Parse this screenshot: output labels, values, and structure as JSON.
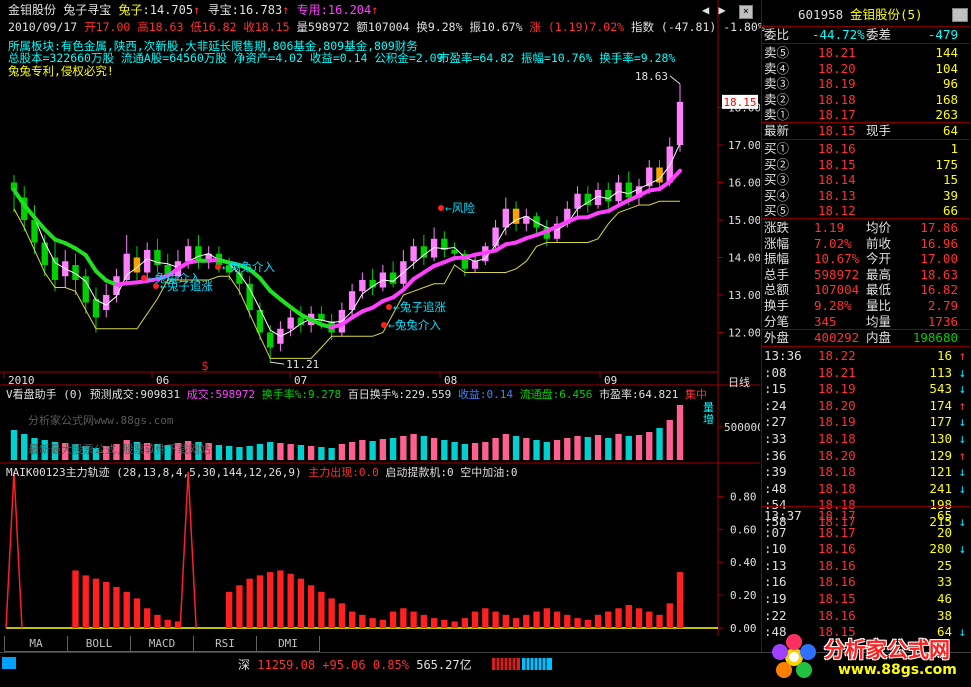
{
  "header": {
    "stock_name": "金钼股份",
    "indicator_name": "兔子寻宝",
    "rabbit_label": "兔子",
    "rabbit_value": "14.705",
    "xunbao_label": "寻宝",
    "xunbao_value": "16.783",
    "zhuanyong_label": "专用",
    "zhuanyong_value": "16.204",
    "window_buttons": [
      "◀",
      "▶",
      "×"
    ]
  },
  "quote_line": {
    "date": "2010/09/17",
    "open": "开17.00",
    "high": "高18.63",
    "low": "低16.82",
    "close": "收18.15",
    "volume": "量598972",
    "amount": "额107004",
    "turnover": "换9.28%",
    "amplitude": "振10.67%",
    "change": "涨 (1.19)7.02%",
    "index": "指数 (-47.81) -1.80%"
  },
  "info_lines": [
    "所属板块:有色金属,陕西,次新股,大非延长限售期,806基金,809基金,809财务",
    "总股本=322660万股 流通A股=64560万股 净资产=4.02 收益=0.14 公积金=2.09",
    "市盈率=64.82 振幅=10.76% 换手率=9.28%",
    "兔兔专利,侵权必究!"
  ],
  "price_axis": [
    "18.00",
    "17.00",
    "16.00",
    "15.00",
    "14.00",
    "13.00",
    "12.00"
  ],
  "price_marker": "18.15",
  "price_high_label": "18.63",
  "price_low_label": "11.21",
  "annotations": [
    "兔兔介入",
    "兔子追涨",
    "兔兔介入",
    "风险",
    "兔子追涨",
    "兔兔介入"
  ],
  "date_axis": [
    "2010",
    "06",
    "07",
    "08",
    "09"
  ],
  "period_label": "日线",
  "volume_header": {
    "title": "V看盘助手 (0)",
    "forecast": "预测成交:909831",
    "volume": "成交:598972",
    "turnover_pct": "换手率%:9.278",
    "hundred_day": "百日换手%:229.559",
    "earnings": "收益:0.14",
    "float": "流通盘:6.456",
    "pe": "市盈率:64.821",
    "concentrate": "集中",
    "volume_tag": "量增",
    "axis": "500000"
  },
  "watermarks": [
    "分析家公式网www.88gs.com",
    "最新最大股票公式,股票软件下载网站"
  ],
  "indicator_header": {
    "title": "MAIK00123主力轨迹",
    "params": "(28,13,8,4,5,30,144,12,26,9)",
    "main_force": "主力出现:0.0",
    "pull_up": "启动提款机:0",
    "air_refuel": "空中加油:0",
    "axis": [
      "0.80",
      "0.60",
      "0.40",
      "0.20",
      "0.00"
    ]
  },
  "tabs": [
    "MA",
    "BOLL",
    "MACD",
    "RSI",
    "DMI"
  ],
  "status": {
    "market": "深",
    "index_value": "11259.08",
    "change": "+95.06",
    "pct": "0.85%",
    "amount": "565.27亿"
  },
  "logo_text": "分析家公式网",
  "logo_url": "www.88gs.com",
  "panel": {
    "code": "601958",
    "name": "金钼股份(5)",
    "weibi_label": "委比",
    "weibi_value": "-44.72%",
    "weicha_label": "委差",
    "weicha_value": "-479",
    "sell": [
      {
        "label": "卖⑤",
        "price": "18.21",
        "vol": "144"
      },
      {
        "label": "卖④",
        "price": "18.20",
        "vol": "104"
      },
      {
        "label": "卖③",
        "price": "18.19",
        "vol": "96"
      },
      {
        "label": "卖②",
        "price": "18.18",
        "vol": "168"
      },
      {
        "label": "卖①",
        "price": "18.17",
        "vol": "263"
      }
    ],
    "latest_label": "最新",
    "latest_value": "18.15",
    "hand_label": "现手",
    "hand_value": "64",
    "buy": [
      {
        "label": "买①",
        "price": "18.16",
        "vol": "1"
      },
      {
        "label": "买②",
        "price": "18.15",
        "vol": "175"
      },
      {
        "label": "买③",
        "price": "18.14",
        "vol": "15"
      },
      {
        "label": "买④",
        "price": "18.13",
        "vol": "39"
      },
      {
        "label": "买⑤",
        "price": "18.12",
        "vol": "66"
      }
    ],
    "stats": [
      {
        "l1": "涨跌",
        "v1": "1.19",
        "l2": "均价",
        "v2": "17.86"
      },
      {
        "l1": "涨幅",
        "v1": "7.02%",
        "l2": "前收",
        "v2": "16.96"
      },
      {
        "l1": "振幅",
        "v1": "10.67%",
        "l2": "今开",
        "v2": "17.00"
      },
      {
        "l1": "总手",
        "v1": "598972",
        "l2": "最高",
        "v2": "18.63"
      },
      {
        "l1": "总额",
        "v1": "107004",
        "l2": "最低",
        "v2": "16.82"
      },
      {
        "l1": "换手",
        "v1": "9.28%",
        "l2": "量比",
        "v2": "2.79"
      },
      {
        "l1": "分笔",
        "v1": "345",
        "l2": "均量",
        "v2": "1736"
      }
    ],
    "outer_label": "外盘",
    "outer_value": "400292",
    "inner_label": "内盘",
    "inner_value": "198680",
    "ticks_a": [
      {
        "t": "13:36",
        "p": "18.22",
        "v": "16",
        "dir": "↑",
        "col": "#ff3030"
      },
      {
        "t": ":08",
        "p": "18.21",
        "v": "113",
        "dir": "↓",
        "col": "#ff3030"
      },
      {
        "t": ":15",
        "p": "18.19",
        "v": "543",
        "dir": "↓",
        "col": "#ff3030"
      },
      {
        "t": ":24",
        "p": "18.20",
        "v": "174",
        "dir": "↑",
        "col": "#ff3030"
      },
      {
        "t": ":27",
        "p": "18.19",
        "v": "177",
        "dir": "↓",
        "col": "#ff3030"
      },
      {
        "t": ":33",
        "p": "18.18",
        "v": "130",
        "dir": "↓",
        "col": "#ff3030"
      },
      {
        "t": ":36",
        "p": "18.20",
        "v": "129",
        "dir": "↑",
        "col": "#ff3030"
      },
      {
        "t": ":39",
        "p": "18.18",
        "v": "121",
        "dir": "↓",
        "col": "#ff3030"
      },
      {
        "t": ":48",
        "p": "18.18",
        "v": "241",
        "dir": "↓",
        "col": "#ff3030"
      },
      {
        "t": ":54",
        "p": "18.18",
        "v": "198",
        "dir": "",
        "col": "#ff3030"
      },
      {
        "t": ":58",
        "p": "18.17",
        "v": "215",
        "dir": "↓",
        "col": "#ff3030"
      }
    ],
    "ticks_b": [
      {
        "t": "13:37",
        "p": "18.17",
        "v": "65",
        "dir": "",
        "col": "#ff3030"
      },
      {
        "t": ":07",
        "p": "18.17",
        "v": "20",
        "dir": "",
        "col": "#ff3030"
      },
      {
        "t": ":10",
        "p": "18.16",
        "v": "280",
        "dir": "↓",
        "col": "#ff3030"
      },
      {
        "t": ":13",
        "p": "18.16",
        "v": "25",
        "dir": "",
        "col": "#ff3030"
      },
      {
        "t": ":16",
        "p": "18.16",
        "v": "33",
        "dir": "",
        "col": "#ff3030"
      },
      {
        "t": ":19",
        "p": "18.15",
        "v": "46",
        "dir": "",
        "col": "#ff3030"
      },
      {
        "t": ":22",
        "p": "18.16",
        "v": "38",
        "dir": "",
        "col": "#ff3030"
      },
      {
        "t": ":48",
        "p": "18.15",
        "v": "64",
        "dir": "↓",
        "col": "#ff3030"
      }
    ]
  },
  "chart_data": {
    "type": "candlestick",
    "title": "",
    "ylim": [
      11.0,
      19.0
    ],
    "candles": [
      {
        "o": 16.0,
        "c": 15.8,
        "h": 16.2,
        "l": 15.2
      },
      {
        "o": 15.6,
        "c": 15.0,
        "h": 15.9,
        "l": 14.7
      },
      {
        "o": 15.0,
        "c": 14.4,
        "h": 15.4,
        "l": 14.1
      },
      {
        "o": 14.4,
        "c": 13.8,
        "h": 14.6,
        "l": 13.5
      },
      {
        "o": 14.0,
        "c": 13.4,
        "h": 14.5,
        "l": 13.1
      },
      {
        "o": 13.5,
        "c": 13.9,
        "h": 14.2,
        "l": 13.2
      },
      {
        "o": 13.8,
        "c": 13.4,
        "h": 14.1,
        "l": 13.0
      },
      {
        "o": 13.5,
        "c": 12.8,
        "h": 13.7,
        "l": 12.5
      },
      {
        "o": 12.9,
        "c": 12.4,
        "h": 13.2,
        "l": 12.0
      },
      {
        "o": 12.6,
        "c": 13.0,
        "h": 13.3,
        "l": 12.4
      },
      {
        "o": 13.0,
        "c": 13.5,
        "h": 13.7,
        "l": 12.8
      },
      {
        "o": 13.4,
        "c": 14.1,
        "h": 14.6,
        "l": 13.3
      },
      {
        "o": 14.0,
        "c": 13.6,
        "h": 14.3,
        "l": 13.4
      },
      {
        "o": 13.6,
        "c": 14.2,
        "h": 14.4,
        "l": 13.4
      },
      {
        "o": 14.2,
        "c": 13.8,
        "h": 14.5,
        "l": 13.6
      },
      {
        "o": 13.8,
        "c": 13.5,
        "h": 14.1,
        "l": 13.3
      },
      {
        "o": 13.5,
        "c": 13.9,
        "h": 14.2,
        "l": 13.4
      },
      {
        "o": 13.9,
        "c": 14.3,
        "h": 14.5,
        "l": 13.7
      },
      {
        "o": 14.3,
        "c": 13.9,
        "h": 14.6,
        "l": 13.7
      },
      {
        "o": 13.9,
        "c": 14.1,
        "h": 14.3,
        "l": 13.7
      },
      {
        "o": 14.1,
        "c": 13.8,
        "h": 14.3,
        "l": 13.6
      },
      {
        "o": 13.8,
        "c": 13.6,
        "h": 14.0,
        "l": 13.4
      },
      {
        "o": 13.6,
        "c": 13.3,
        "h": 13.8,
        "l": 13.0
      },
      {
        "o": 13.3,
        "c": 12.6,
        "h": 13.5,
        "l": 12.4
      },
      {
        "o": 12.6,
        "c": 12.0,
        "h": 12.8,
        "l": 11.8
      },
      {
        "o": 12.0,
        "c": 11.6,
        "h": 12.2,
        "l": 11.21
      },
      {
        "o": 11.7,
        "c": 12.1,
        "h": 12.3,
        "l": 11.5
      },
      {
        "o": 12.1,
        "c": 12.4,
        "h": 12.6,
        "l": 11.9
      },
      {
        "o": 12.4,
        "c": 12.2,
        "h": 12.7,
        "l": 12.0
      },
      {
        "o": 12.2,
        "c": 12.5,
        "h": 12.7,
        "l": 12.0
      },
      {
        "o": 12.5,
        "c": 12.3,
        "h": 12.7,
        "l": 12.1
      },
      {
        "o": 12.3,
        "c": 12.0,
        "h": 12.5,
        "l": 11.8
      },
      {
        "o": 12.0,
        "c": 12.6,
        "h": 12.8,
        "l": 11.9
      },
      {
        "o": 12.6,
        "c": 13.1,
        "h": 13.3,
        "l": 12.4
      },
      {
        "o": 13.1,
        "c": 13.4,
        "h": 13.6,
        "l": 12.9
      },
      {
        "o": 13.4,
        "c": 13.2,
        "h": 13.7,
        "l": 13.0
      },
      {
        "o": 13.2,
        "c": 13.6,
        "h": 13.8,
        "l": 13.1
      },
      {
        "o": 13.6,
        "c": 13.3,
        "h": 13.9,
        "l": 13.2
      },
      {
        "o": 13.3,
        "c": 13.9,
        "h": 14.2,
        "l": 13.2
      },
      {
        "o": 13.9,
        "c": 14.3,
        "h": 14.5,
        "l": 13.7
      },
      {
        "o": 14.3,
        "c": 14.0,
        "h": 14.6,
        "l": 13.8
      },
      {
        "o": 14.0,
        "c": 14.5,
        "h": 14.8,
        "l": 13.9
      },
      {
        "o": 14.5,
        "c": 14.2,
        "h": 14.7,
        "l": 14.0
      },
      {
        "o": 14.2,
        "c": 14.1,
        "h": 14.4,
        "l": 13.9
      },
      {
        "o": 14.1,
        "c": 13.7,
        "h": 14.2,
        "l": 13.5
      },
      {
        "o": 13.7,
        "c": 13.9,
        "h": 14.1,
        "l": 13.6
      },
      {
        "o": 13.9,
        "c": 14.3,
        "h": 14.4,
        "l": 13.8
      },
      {
        "o": 14.3,
        "c": 14.8,
        "h": 15.0,
        "l": 14.2
      },
      {
        "o": 14.8,
        "c": 15.3,
        "h": 15.6,
        "l": 14.6
      },
      {
        "o": 15.3,
        "c": 14.9,
        "h": 15.5,
        "l": 14.7
      },
      {
        "o": 14.9,
        "c": 15.1,
        "h": 15.3,
        "l": 14.7
      },
      {
        "o": 15.1,
        "c": 14.8,
        "h": 15.2,
        "l": 14.6
      },
      {
        "o": 14.8,
        "c": 14.5,
        "h": 15.0,
        "l": 14.3
      },
      {
        "o": 14.5,
        "c": 14.9,
        "h": 15.1,
        "l": 14.4
      },
      {
        "o": 14.9,
        "c": 15.3,
        "h": 15.5,
        "l": 14.8
      },
      {
        "o": 15.3,
        "c": 15.7,
        "h": 15.9,
        "l": 15.1
      },
      {
        "o": 15.7,
        "c": 15.4,
        "h": 15.9,
        "l": 15.2
      },
      {
        "o": 15.4,
        "c": 15.8,
        "h": 16.0,
        "l": 15.3
      },
      {
        "o": 15.8,
        "c": 15.5,
        "h": 16.0,
        "l": 15.3
      },
      {
        "o": 15.5,
        "c": 16.0,
        "h": 16.2,
        "l": 15.4
      },
      {
        "o": 16.0,
        "c": 15.6,
        "h": 16.3,
        "l": 15.4
      },
      {
        "o": 15.6,
        "c": 15.9,
        "h": 16.1,
        "l": 15.4
      },
      {
        "o": 15.9,
        "c": 16.4,
        "h": 16.6,
        "l": 15.7
      },
      {
        "o": 16.4,
        "c": 16.0,
        "h": 16.6,
        "l": 15.8
      },
      {
        "o": 16.0,
        "c": 16.96,
        "h": 17.2,
        "l": 15.9
      },
      {
        "o": 17.0,
        "c": 18.15,
        "h": 18.63,
        "l": 16.82
      }
    ],
    "volume": [
      30,
      26,
      22,
      20,
      18,
      17,
      16,
      14,
      12,
      14,
      16,
      20,
      18,
      17,
      16,
      15,
      17,
      19,
      18,
      17,
      15,
      14,
      13,
      14,
      16,
      18,
      17,
      16,
      15,
      14,
      13,
      12,
      16,
      18,
      20,
      19,
      21,
      22,
      24,
      26,
      24,
      22,
      20,
      18,
      16,
      17,
      18,
      22,
      26,
      24,
      22,
      20,
      18,
      20,
      22,
      24,
      23,
      25,
      22,
      26,
      24,
      25,
      28,
      32,
      40,
      55
    ],
    "indicator": [
      0.95,
      0,
      0,
      0,
      0,
      0,
      0.35,
      0.32,
      0.3,
      0.28,
      0.25,
      0.22,
      0.18,
      0.12,
      0.08,
      0.05,
      0.04,
      0.95,
      0,
      0,
      0,
      0.22,
      0.26,
      0.3,
      0.32,
      0.34,
      0.35,
      0.33,
      0.3,
      0.26,
      0.22,
      0.18,
      0.15,
      0.1,
      0.08,
      0.06,
      0.05,
      0.1,
      0.12,
      0.1,
      0.08,
      0.06,
      0.05,
      0.04,
      0.06,
      0.1,
      0.12,
      0.1,
      0.08,
      0.06,
      0.08,
      0.1,
      0.12,
      0.1,
      0.08,
      0.06,
      0.05,
      0.08,
      0.1,
      0.12,
      0.14,
      0.12,
      0.1,
      0.08,
      0.15,
      0.34
    ]
  }
}
